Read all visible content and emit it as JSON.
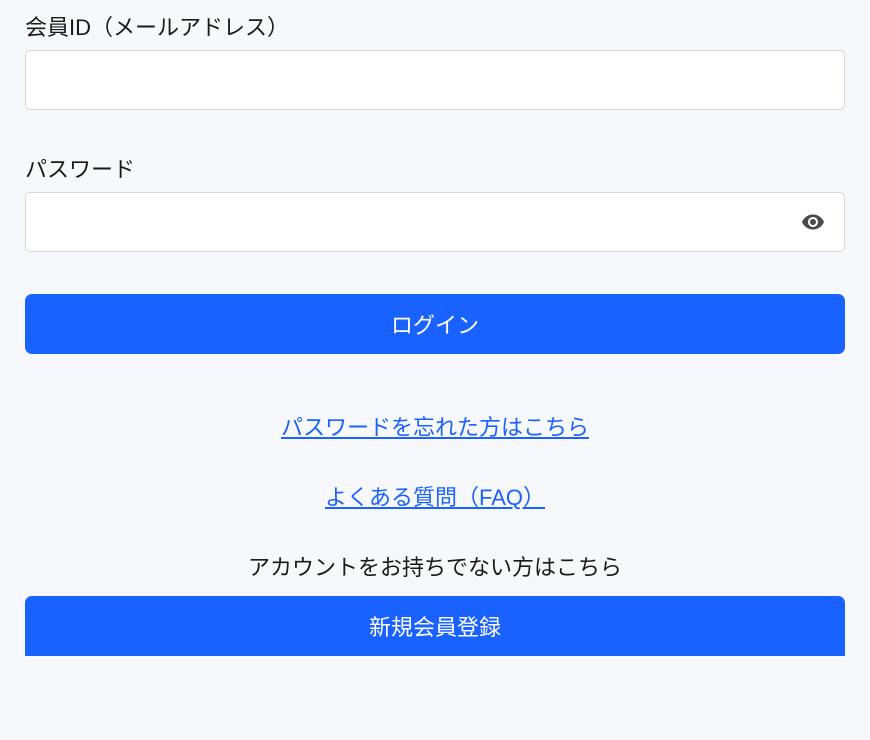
{
  "form": {
    "email_label": "会員ID（メールアドレス）",
    "email_value": "",
    "password_label": "パスワード",
    "password_value": ""
  },
  "buttons": {
    "login_label": "ログイン",
    "register_label": "新規会員登録"
  },
  "links": {
    "forgot_password": "パスワードを忘れた方はこちら",
    "faq": "よくある質問（FAQ）"
  },
  "signup": {
    "prompt": "アカウントをお持ちでない方はこちら"
  },
  "colors": {
    "primary": "#1a62ff",
    "background": "#f7f8fb",
    "input_border": "#d6d8de"
  }
}
